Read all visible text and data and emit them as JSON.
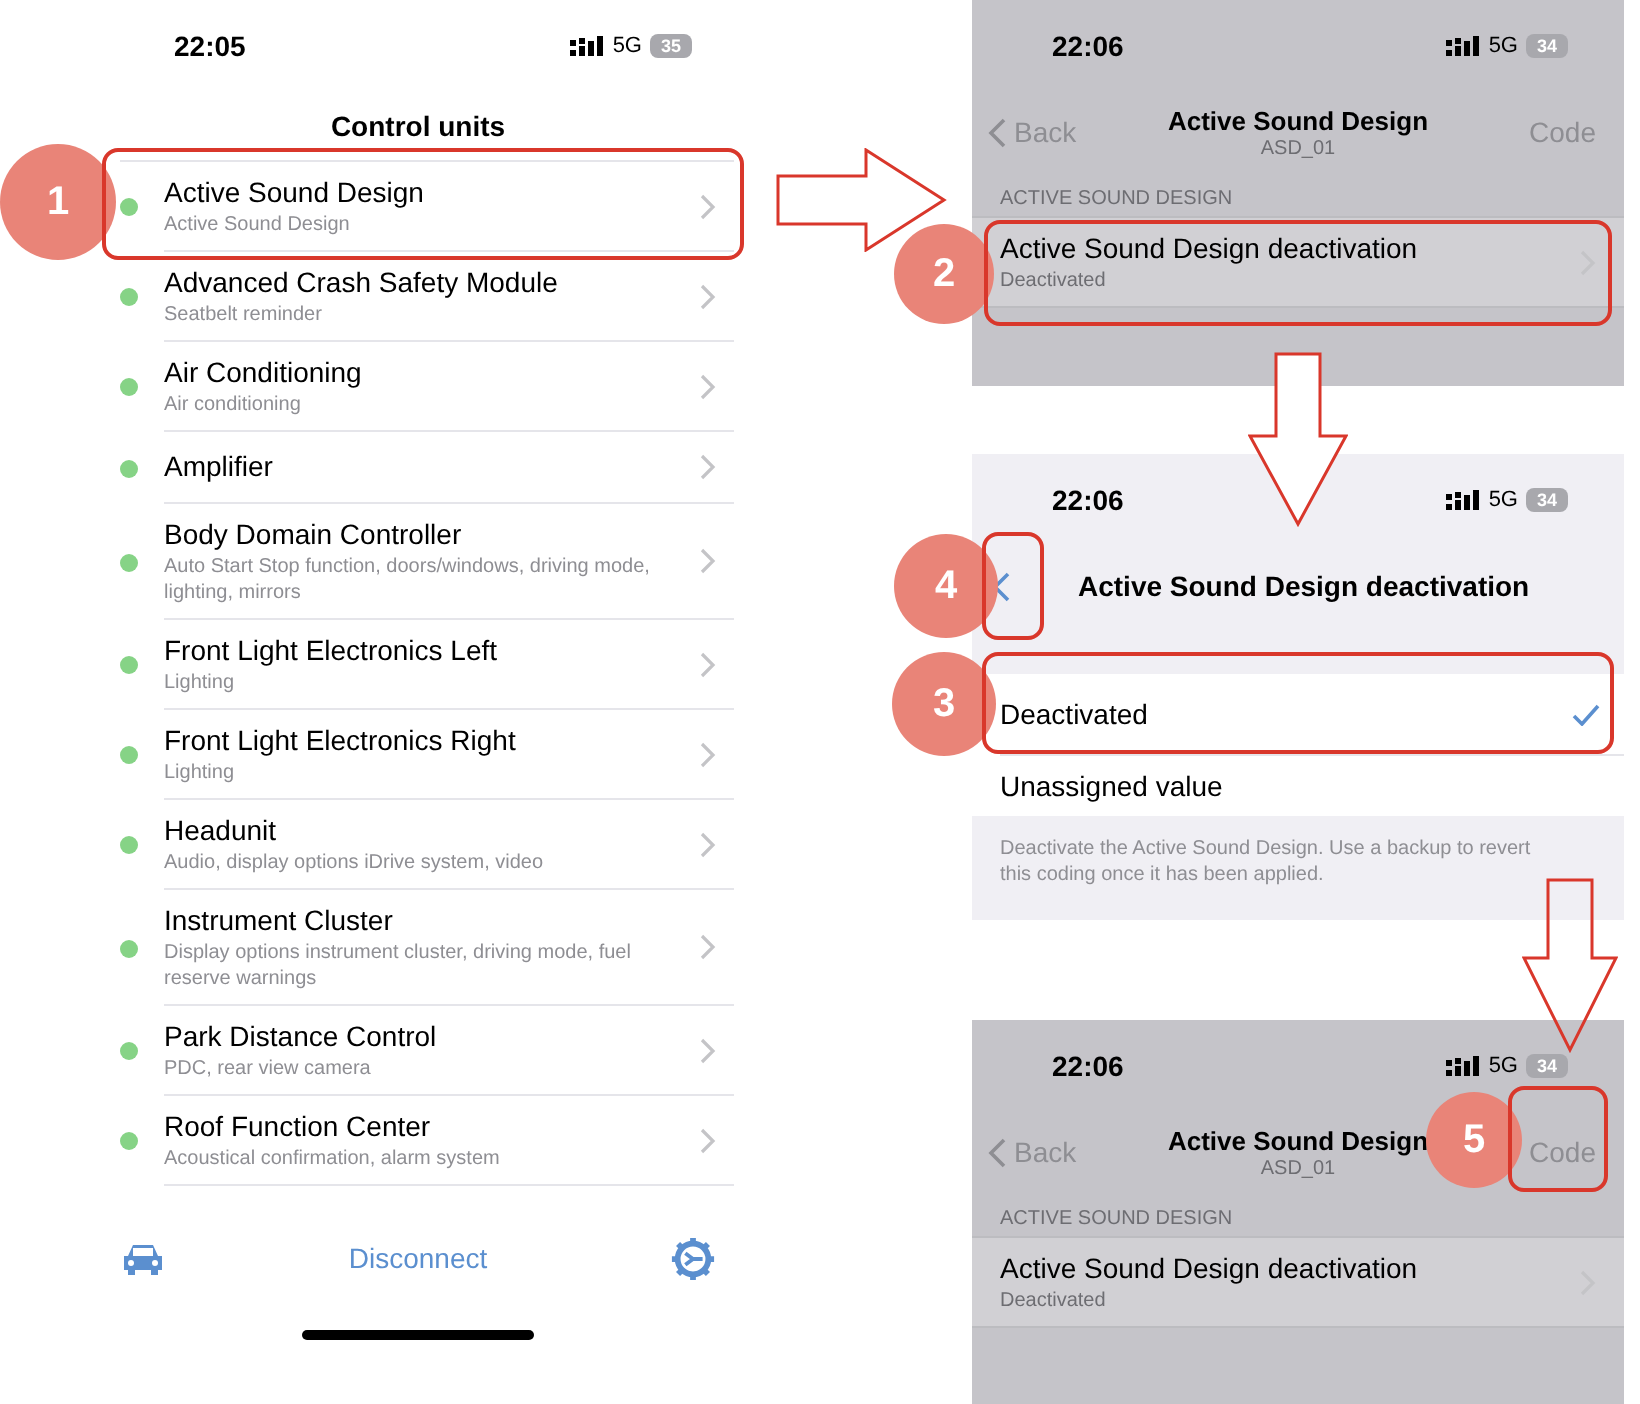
{
  "control_units_screen": {
    "status_bar": {
      "time": "22:05",
      "network": "5G",
      "battery": "35"
    },
    "title": "Control units",
    "units": [
      {
        "name": "Active Sound Design",
        "description": "Active Sound Design",
        "color": "#86d386"
      },
      {
        "name": "Advanced Crash Safety Module",
        "description": "Seatbelt reminder",
        "color": "#86d386"
      },
      {
        "name": "Air Conditioning",
        "description": "Air conditioning",
        "color": "#86d386"
      },
      {
        "name": "Amplifier",
        "color": "#86d386"
      },
      {
        "name": "Body Domain Controller",
        "description": "Auto Start Stop function, doors/windows, driving mode, lighting, mirrors",
        "color": "#86d386"
      },
      {
        "name": "Front Light Electronics Left",
        "description": "Lighting",
        "color": "#86d386"
      },
      {
        "name": "Front Light Electronics Right",
        "description": "Lighting",
        "color": "#86d386"
      },
      {
        "name": "Headunit",
        "description": "Audio, display options iDrive system, video",
        "color": "#86d386"
      },
      {
        "name": "Instrument Cluster",
        "description": "Display options instrument cluster, driving mode, fuel reserve warnings",
        "color": "#86d386"
      },
      {
        "name": "Park Distance Control",
        "description": "PDC, rear view camera",
        "color": "#86d386"
      },
      {
        "name": "Roof Function Center",
        "description": "Acoustical confirmation, alarm system",
        "color": "#86d386"
      }
    ],
    "bottom_bar": {
      "disconnect": "Disconnect"
    }
  },
  "detail_screens": [
    {
      "status_bar": {
        "time": "22:06",
        "network": "5G",
        "battery": "34"
      },
      "back": "Back",
      "title": "Active Sound Design",
      "subtitle": "ASD_01",
      "code": "Code",
      "section": "ACTIVE SOUND DESIGN",
      "row": {
        "title": "Active Sound Design deactivation",
        "value": "Deactivated"
      }
    },
    {
      "status_bar": {
        "time": "22:06",
        "network": "5G",
        "battery": "34"
      },
      "back": "Back",
      "title": "Active Sound Design",
      "subtitle": "ASD_01",
      "code": "Code",
      "section": "ACTIVE SOUND DESIGN",
      "row": {
        "title": "Active Sound Design deactivation",
        "value": "Deactivated"
      }
    }
  ],
  "option_screen": {
    "status_bar": {
      "time": "22:06",
      "network": "5G",
      "battery": "34"
    },
    "title": "Active Sound Design deactivation",
    "options": [
      {
        "label": "Deactivated",
        "selected": true
      },
      {
        "label": "Unassigned value",
        "selected": false
      }
    ],
    "footer": "Deactivate the Active Sound Design. Use a backup to revert this coding once it has been applied."
  },
  "annotations": [
    {
      "label": "1"
    },
    {
      "label": "2"
    },
    {
      "label": "4"
    },
    {
      "label": "3"
    },
    {
      "label": "5"
    }
  ]
}
